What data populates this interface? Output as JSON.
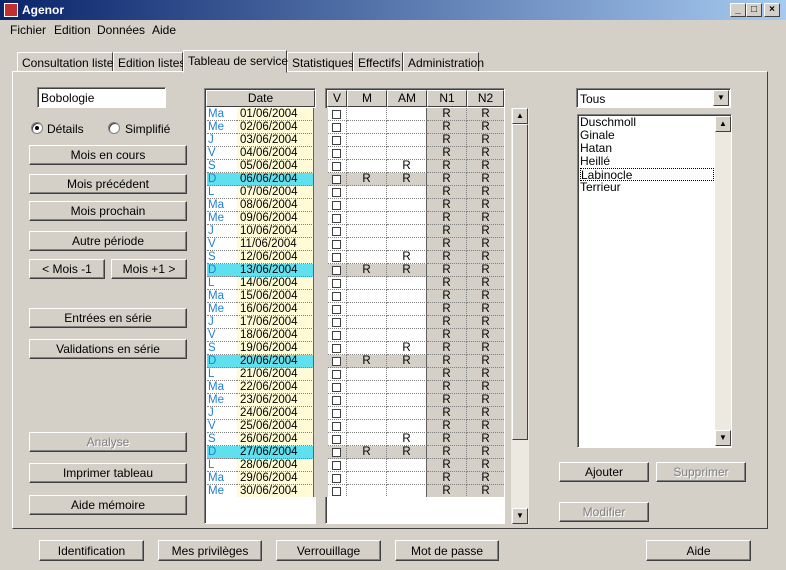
{
  "window": {
    "title": "Agenor",
    "min": "_",
    "max": "□",
    "close": "×"
  },
  "menu": [
    "Fichier",
    "Edition",
    "Données",
    "Aide"
  ],
  "tabs": [
    "Consultation listes",
    "Edition listes",
    "Tableau de service",
    "Statistiques",
    "Effectifs",
    "Administration"
  ],
  "left": {
    "name_value": "Bobologie",
    "radio_details": "Détails",
    "radio_simplifie": "Simplifié",
    "btn_mois_cours": "Mois en cours",
    "btn_mois_prec": "Mois précédent",
    "btn_mois_proch": "Mois prochain",
    "btn_autre": "Autre période",
    "btn_moins": "< Mois -1",
    "btn_plus": "Mois +1 >",
    "btn_entrees": "Entrées en série",
    "btn_validations": "Validations en série",
    "btn_analyse": "Analyse",
    "btn_imprimer": "Imprimer tableau",
    "btn_aide_memoire": "Aide mémoire"
  },
  "grid": {
    "headers": {
      "date": "Date",
      "v": "V",
      "m": "M",
      "am": "AM",
      "n1": "N1",
      "n2": "N2"
    },
    "rows": [
      {
        "day": "Ma",
        "date": "01/06/2004",
        "m": "",
        "am": "",
        "n1": "R",
        "n2": "R",
        "wk": false
      },
      {
        "day": "Me",
        "date": "02/06/2004",
        "m": "",
        "am": "",
        "n1": "R",
        "n2": "R",
        "wk": false
      },
      {
        "day": "J",
        "date": "03/06/2004",
        "m": "",
        "am": "",
        "n1": "R",
        "n2": "R",
        "wk": false
      },
      {
        "day": "V",
        "date": "04/06/2004",
        "m": "",
        "am": "",
        "n1": "R",
        "n2": "R",
        "wk": false
      },
      {
        "day": "S",
        "date": "05/06/2004",
        "m": "",
        "am": "R",
        "n1": "R",
        "n2": "R",
        "wk": false
      },
      {
        "day": "D",
        "date": "06/06/2004",
        "m": "R",
        "am": "R",
        "n1": "R",
        "n2": "R",
        "wk": true
      },
      {
        "day": "L",
        "date": "07/06/2004",
        "m": "",
        "am": "",
        "n1": "R",
        "n2": "R",
        "wk": false
      },
      {
        "day": "Ma",
        "date": "08/06/2004",
        "m": "",
        "am": "",
        "n1": "R",
        "n2": "R",
        "wk": false
      },
      {
        "day": "Me",
        "date": "09/06/2004",
        "m": "",
        "am": "",
        "n1": "R",
        "n2": "R",
        "wk": false
      },
      {
        "day": "J",
        "date": "10/06/2004",
        "m": "",
        "am": "",
        "n1": "R",
        "n2": "R",
        "wk": false
      },
      {
        "day": "V",
        "date": "11/06/2004",
        "m": "",
        "am": "",
        "n1": "R",
        "n2": "R",
        "wk": false
      },
      {
        "day": "S",
        "date": "12/06/2004",
        "m": "",
        "am": "R",
        "n1": "R",
        "n2": "R",
        "wk": false
      },
      {
        "day": "D",
        "date": "13/06/2004",
        "m": "R",
        "am": "R",
        "n1": "R",
        "n2": "R",
        "wk": true
      },
      {
        "day": "L",
        "date": "14/06/2004",
        "m": "",
        "am": "",
        "n1": "R",
        "n2": "R",
        "wk": false
      },
      {
        "day": "Ma",
        "date": "15/06/2004",
        "m": "",
        "am": "",
        "n1": "R",
        "n2": "R",
        "wk": false
      },
      {
        "day": "Me",
        "date": "16/06/2004",
        "m": "",
        "am": "",
        "n1": "R",
        "n2": "R",
        "wk": false
      },
      {
        "day": "J",
        "date": "17/06/2004",
        "m": "",
        "am": "",
        "n1": "R",
        "n2": "R",
        "wk": false
      },
      {
        "day": "V",
        "date": "18/06/2004",
        "m": "",
        "am": "",
        "n1": "R",
        "n2": "R",
        "wk": false
      },
      {
        "day": "S",
        "date": "19/06/2004",
        "m": "",
        "am": "R",
        "n1": "R",
        "n2": "R",
        "wk": false
      },
      {
        "day": "D",
        "date": "20/06/2004",
        "m": "R",
        "am": "R",
        "n1": "R",
        "n2": "R",
        "wk": true
      },
      {
        "day": "L",
        "date": "21/06/2004",
        "m": "",
        "am": "",
        "n1": "R",
        "n2": "R",
        "wk": false
      },
      {
        "day": "Ma",
        "date": "22/06/2004",
        "m": "",
        "am": "",
        "n1": "R",
        "n2": "R",
        "wk": false
      },
      {
        "day": "Me",
        "date": "23/06/2004",
        "m": "",
        "am": "",
        "n1": "R",
        "n2": "R",
        "wk": false
      },
      {
        "day": "J",
        "date": "24/06/2004",
        "m": "",
        "am": "",
        "n1": "R",
        "n2": "R",
        "wk": false
      },
      {
        "day": "V",
        "date": "25/06/2004",
        "m": "",
        "am": "",
        "n1": "R",
        "n2": "R",
        "wk": false
      },
      {
        "day": "S",
        "date": "26/06/2004",
        "m": "",
        "am": "R",
        "n1": "R",
        "n2": "R",
        "wk": false
      },
      {
        "day": "D",
        "date": "27/06/2004",
        "m": "R",
        "am": "R",
        "n1": "R",
        "n2": "R",
        "wk": true
      },
      {
        "day": "L",
        "date": "28/06/2004",
        "m": "",
        "am": "",
        "n1": "R",
        "n2": "R",
        "wk": false
      },
      {
        "day": "Ma",
        "date": "29/06/2004",
        "m": "",
        "am": "",
        "n1": "R",
        "n2": "R",
        "wk": false
      },
      {
        "day": "Me",
        "date": "30/06/2004",
        "m": "",
        "am": "",
        "n1": "R",
        "n2": "R",
        "wk": false
      }
    ]
  },
  "right": {
    "filter_value": "Tous",
    "list": [
      "Duschmoll",
      "Ginale",
      "Hatan",
      "Heillé",
      "Labinocle",
      "Terrieur"
    ],
    "selected_index": 4,
    "btn_ajouter": "Ajouter",
    "btn_supprimer": "Supprimer",
    "btn_modifier": "Modifier"
  },
  "bottom": {
    "btn_identification": "Identification",
    "btn_privileges": "Mes privilèges",
    "btn_verrouillage": "Verrouillage",
    "btn_mdp": "Mot de passe",
    "btn_aide": "Aide"
  },
  "icons": {
    "up": "▲",
    "down": "▼"
  }
}
